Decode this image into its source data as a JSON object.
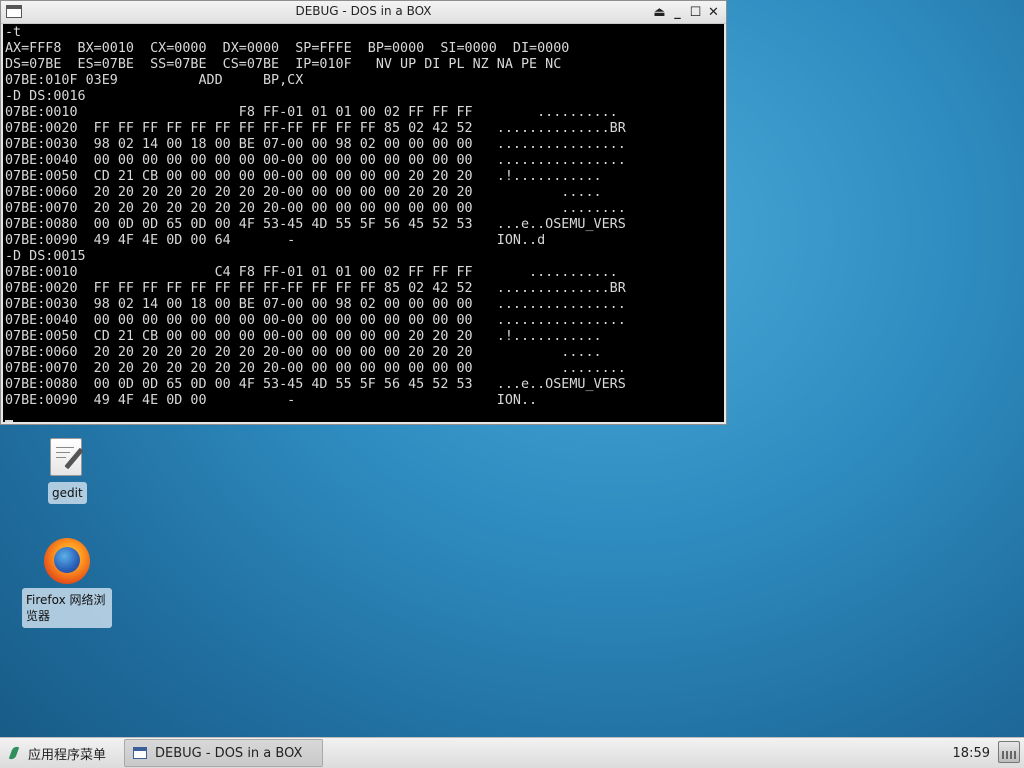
{
  "window": {
    "title": "DEBUG - DOS in a BOX",
    "buttons": {
      "shade": "⏏",
      "minimize": "_",
      "maximize": "☐",
      "close": "✕"
    }
  },
  "terminal": {
    "lines": [
      "-t",
      "AX=FFF8  BX=0010  CX=0000  DX=0000  SP=FFFE  BP=0000  SI=0000  DI=0000",
      "DS=07BE  ES=07BE  SS=07BE  CS=07BE  IP=010F   NV UP DI PL NZ NA PE NC",
      "07BE:010F 03E9          ADD     BP,CX",
      "-D DS:0016",
      "07BE:0010                    F8 FF-01 01 01 00 02 FF FF FF        ..........",
      "07BE:0020  FF FF FF FF FF FF FF FF-FF FF FF FF 85 02 42 52   ..............BR",
      "07BE:0030  98 02 14 00 18 00 BE 07-00 00 98 02 00 00 00 00   ................",
      "07BE:0040  00 00 00 00 00 00 00 00-00 00 00 00 00 00 00 00   ................",
      "07BE:0050  CD 21 CB 00 00 00 00 00-00 00 00 00 00 20 20 20   .!...........",
      "07BE:0060  20 20 20 20 20 20 20 20-00 00 00 00 00 20 20 20           .....",
      "07BE:0070  20 20 20 20 20 20 20 20-00 00 00 00 00 00 00 00           ........",
      "07BE:0080  00 0D 0D 65 0D 00 4F 53-45 4D 55 5F 56 45 52 53   ...e..OSEMU_VERS",
      "07BE:0090  49 4F 4E 0D 00 64       -                         ION..d",
      "-D DS:0015",
      "07BE:0010                 C4 F8 FF-01 01 01 00 02 FF FF FF       ...........",
      "07BE:0020  FF FF FF FF FF FF FF FF-FF FF FF FF 85 02 42 52   ..............BR",
      "07BE:0030  98 02 14 00 18 00 BE 07-00 00 98 02 00 00 00 00   ................",
      "07BE:0040  00 00 00 00 00 00 00 00-00 00 00 00 00 00 00 00   ................",
      "07BE:0050  CD 21 CB 00 00 00 00 00-00 00 00 00 00 20 20 20   .!...........",
      "07BE:0060  20 20 20 20 20 20 20 20-00 00 00 00 00 20 20 20           .....",
      "07BE:0070  20 20 20 20 20 20 20 20-00 00 00 00 00 00 00 00           ........",
      "07BE:0080  00 0D 0D 65 0D 00 4F 53-45 4D 55 5F 56 45 52 53   ...e..OSEMU_VERS",
      "07BE:0090  49 4F 4E 0D 00          -                         ION.."
    ]
  },
  "desktop": {
    "gedit_label": "gedit",
    "firefox_label": "Firefox 网络浏览器"
  },
  "taskbar": {
    "apps_menu_label": "应用程序菜单",
    "task_label": "DEBUG - DOS in a BOX",
    "clock": "18:59"
  },
  "colors": {
    "terminal_bg": "#000000",
    "terminal_fg": "#d8d8d8",
    "desktop_bg": "#2f8cc0"
  }
}
